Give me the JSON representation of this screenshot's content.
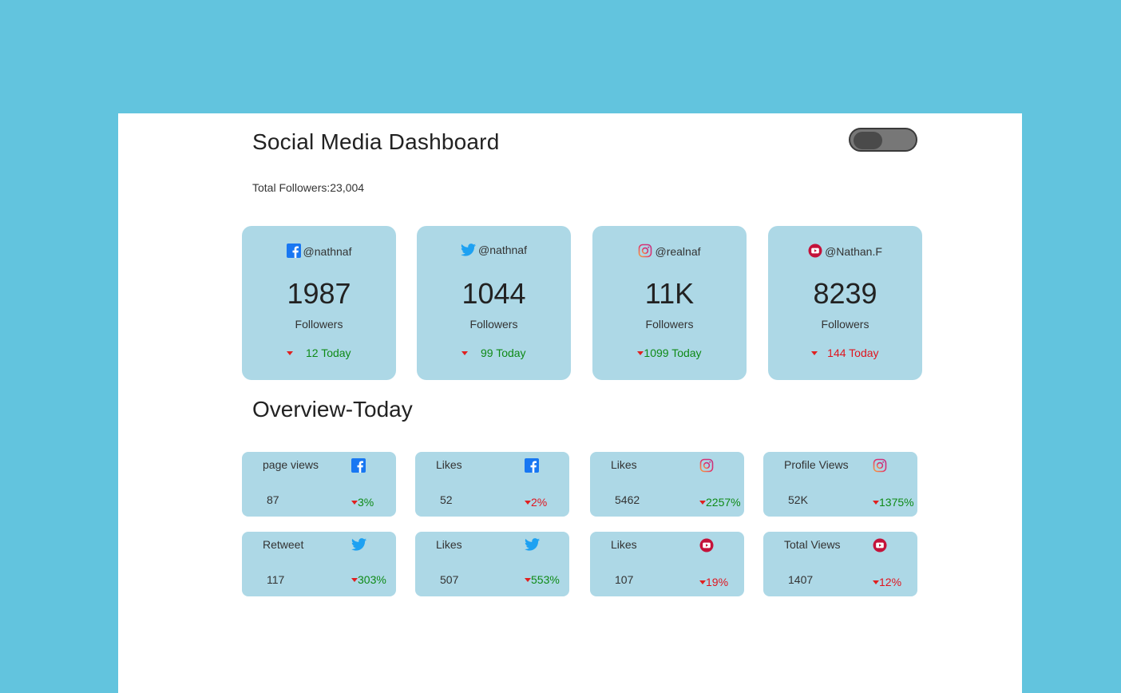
{
  "header": {
    "title": "Social Media Dashboard",
    "total_followers": "Total Followers:23,004"
  },
  "cards": [
    {
      "icon": "facebook-icon",
      "handle": "@nathnaf",
      "count": "1987",
      "label": "Followers",
      "today": "12 Today",
      "trend": "green"
    },
    {
      "icon": "twitter-icon",
      "handle": "@nathnaf",
      "count": "1044",
      "label": "Followers",
      "today": "99 Today",
      "trend": "green"
    },
    {
      "icon": "instagram-icon",
      "handle": "@realnaf",
      "count": "11K",
      "label": "Followers",
      "today": "1099 Today",
      "trend": "green"
    },
    {
      "icon": "youtube-icon",
      "handle": "@Nathan.F",
      "count": "8239",
      "label": "Followers",
      "today": "144 Today",
      "trend": "red"
    }
  ],
  "overview": {
    "title": "Overview-Today",
    "items": [
      {
        "label": "page views",
        "icon": "facebook-icon",
        "value": "87",
        "change": "3%",
        "trend": "green"
      },
      {
        "label": "Likes",
        "icon": "facebook-icon",
        "value": "52",
        "change": "2%",
        "trend": "red"
      },
      {
        "label": "Likes",
        "icon": "instagram-icon",
        "value": "5462",
        "change": "2257%",
        "trend": "green"
      },
      {
        "label": "Profile Views",
        "icon": "instagram-icon",
        "value": "52K",
        "change": "1375%",
        "trend": "green"
      },
      {
        "label": "Retweet",
        "icon": "twitter-icon",
        "value": "117",
        "change": "303%",
        "trend": "green"
      },
      {
        "label": "Likes",
        "icon": "twitter-icon",
        "value": "507",
        "change": "553%",
        "trend": "green"
      },
      {
        "label": "Likes",
        "icon": "youtube-icon",
        "value": "107",
        "change": "19%",
        "trend": "red"
      },
      {
        "label": "Total Views",
        "icon": "youtube-icon",
        "value": "1407",
        "change": "12%",
        "trend": "red"
      }
    ]
  },
  "colors": {
    "background": "#62c4de",
    "card": "#add8e6",
    "up": "#0e8a16",
    "down": "#e0141e"
  }
}
